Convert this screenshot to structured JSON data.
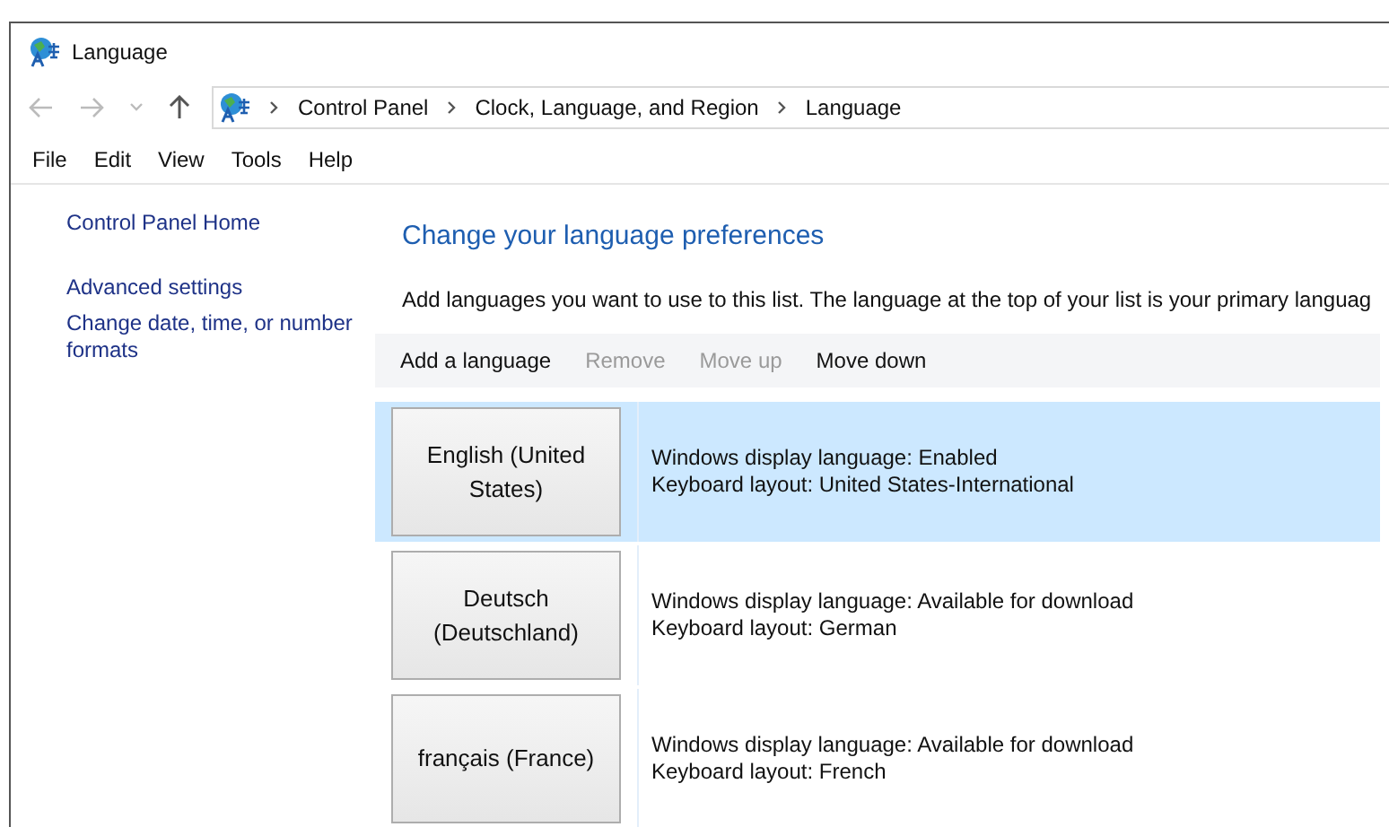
{
  "window": {
    "title": "Language"
  },
  "address_bar": {
    "crumbs": [
      "Control Panel",
      "Clock, Language, and Region",
      "Language"
    ]
  },
  "menu": [
    "File",
    "Edit",
    "View",
    "Tools",
    "Help"
  ],
  "sidebar": {
    "items": [
      "Control Panel Home",
      "Advanced settings",
      "Change date, time, or number formats"
    ]
  },
  "main": {
    "heading": "Change your language preferences",
    "description": "Add languages you want to use to this list. The language at the top of your list is your primary languag"
  },
  "toolbar": [
    {
      "label": "Add a language",
      "disabled": false
    },
    {
      "label": "Remove",
      "disabled": true
    },
    {
      "label": "Move up",
      "disabled": true
    },
    {
      "label": "Move down",
      "disabled": false
    }
  ],
  "languages": [
    {
      "name": "English (United States)",
      "display": "Windows display language: Enabled",
      "keyboard": "Keyboard layout: United States-International",
      "selected": true
    },
    {
      "name": "Deutsch (Deutschland)",
      "display": "Windows display language: Available for download",
      "keyboard": "Keyboard layout: German",
      "selected": false
    },
    {
      "name": "français (France)",
      "display": "Windows display language: Available for download",
      "keyboard": "Keyboard layout: French",
      "selected": false
    }
  ]
}
